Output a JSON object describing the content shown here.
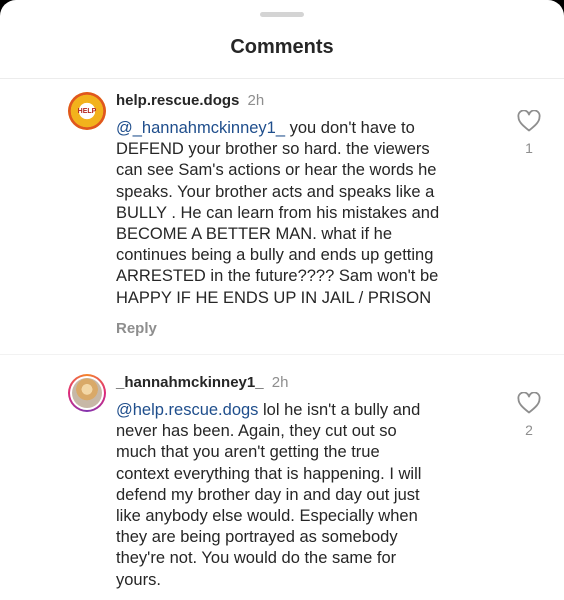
{
  "header": {
    "title": "Comments"
  },
  "comments": [
    {
      "username": "help.rescue.dogs",
      "time": "2h",
      "avatar_text": "HELP",
      "mention": "@_hannahmckinney1_",
      "lines": [
        " you don't have to",
        "DEFEND your brother so hard. the viewers",
        "can see Sam's actions or hear the words he",
        "speaks. Your brother acts and speaks like a",
        "BULLY . He can learn from his mistakes and",
        "BECOME A BETTER MAN. what if he",
        "continues being a bully and ends up getting",
        "ARRESTED in the future???? Sam won't be",
        "HAPPY IF HE ENDS UP IN JAIL / PRISON"
      ],
      "reply_label": "Reply",
      "likes": "1"
    },
    {
      "username": "_hannahmckinney1_",
      "time": "2h",
      "mention": "@help.rescue.dogs",
      "lines": [
        " lol he isn't a bully and",
        "never has been. Again, they cut out so",
        "much that you aren't getting the true",
        "context everything that is happening. I will",
        "defend my brother day in and day out just",
        "like anybody else would. Especially when",
        "they are being portrayed as somebody",
        "they're not. You would do the same for",
        "yours."
      ],
      "likes": "2"
    }
  ],
  "icons": {
    "like": "heart-outline-icon"
  },
  "colors": {
    "mention": "#1f4e8c",
    "muted": "#8e8e8e",
    "text": "#262626"
  }
}
